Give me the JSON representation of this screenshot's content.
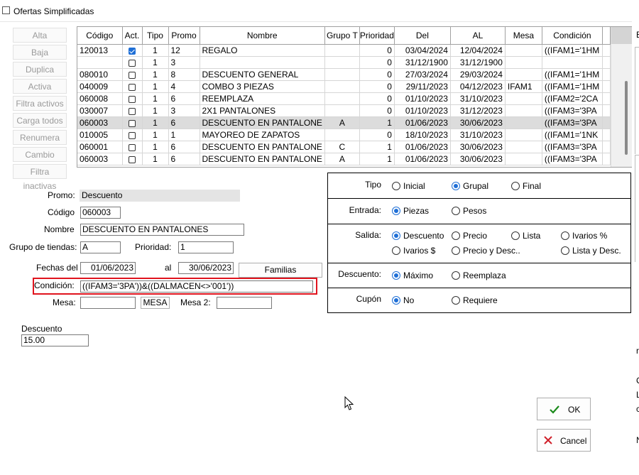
{
  "window": {
    "title": "Ofertas Simplificadas"
  },
  "side_buttons": [
    "Alta",
    "Baja",
    "Duplica",
    "Activa",
    "Filtra activos",
    "Carga todos",
    "Renumera",
    "Cambio",
    "Filtra inactivas"
  ],
  "grid": {
    "headers": [
      "Código",
      "Act.",
      "Tipo",
      "Promo",
      "Nombre",
      "Grupo T",
      "Prioridad",
      "Del",
      "AL",
      "Mesa",
      "Condición"
    ],
    "rows": [
      {
        "codigo": "120013",
        "act": true,
        "tipo": "1",
        "promo": "12",
        "nombre": "REGALO",
        "grupo": "",
        "prioridad": "0",
        "del": "03/04/2024",
        "al": "12/04/2024",
        "mesa": "",
        "condicion": "((IFAM1='1HM"
      },
      {
        "codigo": "",
        "act": false,
        "tipo": "1",
        "promo": "3",
        "nombre": "",
        "grupo": "",
        "prioridad": "0",
        "del": "31/12/1900",
        "al": "31/12/1900",
        "mesa": "",
        "condicion": ""
      },
      {
        "codigo": "080010",
        "act": false,
        "tipo": "1",
        "promo": "8",
        "nombre": "DESCUENTO GENERAL",
        "grupo": "",
        "prioridad": "0",
        "del": "27/03/2024",
        "al": "29/03/2024",
        "mesa": "",
        "condicion": "((IFAM1='1HM"
      },
      {
        "codigo": "040009",
        "act": false,
        "tipo": "1",
        "promo": "4",
        "nombre": "COMBO 3 PIEZAS",
        "grupo": "",
        "prioridad": "0",
        "del": "29/11/2023",
        "al": "04/12/2023",
        "mesa": "IFAM1",
        "condicion": "((IFAM1='1HM"
      },
      {
        "codigo": "060008",
        "act": false,
        "tipo": "1",
        "promo": "6",
        "nombre": "REEMPLAZA",
        "grupo": "",
        "prioridad": "0",
        "del": "01/10/2023",
        "al": "31/10/2023",
        "mesa": "",
        "condicion": "((IFAM2='2CA"
      },
      {
        "codigo": "030007",
        "act": false,
        "tipo": "1",
        "promo": "3",
        "nombre": "2X1 PANTALONES",
        "grupo": "",
        "prioridad": "0",
        "del": "01/10/2023",
        "al": "31/12/2023",
        "mesa": "",
        "condicion": "((IFAM3='3PA"
      },
      {
        "codigo": "060003",
        "act": false,
        "tipo": "1",
        "promo": "6",
        "nombre": "DESCUENTO EN PANTALONE",
        "grupo": "A",
        "prioridad": "1",
        "del": "01/06/2023",
        "al": "30/06/2023",
        "mesa": "",
        "condicion": "((IFAM3='3PA",
        "selected": true
      },
      {
        "codigo": "010005",
        "act": false,
        "tipo": "1",
        "promo": "1",
        "nombre": "MAYOREO DE ZAPATOS",
        "grupo": "",
        "prioridad": "0",
        "del": "18/10/2023",
        "al": "31/10/2023",
        "mesa": "",
        "condicion": "((IFAM1='1NK"
      },
      {
        "codigo": "060001",
        "act": false,
        "tipo": "1",
        "promo": "6",
        "nombre": "DESCUENTO EN PANTALONE",
        "grupo": "C",
        "prioridad": "1",
        "del": "01/06/2023",
        "al": "30/06/2023",
        "mesa": "",
        "condicion": "((IFAM3='3PA"
      },
      {
        "codigo": "060003",
        "act": false,
        "tipo": "1",
        "promo": "6",
        "nombre": "DESCUENTO EN PANTALONE",
        "grupo": "A",
        "prioridad": "1",
        "del": "01/06/2023",
        "al": "30/06/2023",
        "mesa": "",
        "condicion": "((IFAM3='3PA"
      }
    ]
  },
  "form": {
    "promo_label": "Promo:",
    "promo_value": "Descuento",
    "codigo_label": "Código",
    "codigo_value": "060003",
    "nombre_label": "Nombre",
    "nombre_value": "DESCUENTO EN PANTALONES",
    "grupo_label": "Grupo de tiendas:",
    "grupo_value": "A",
    "prioridad_label": "Prioridad:",
    "prioridad_value": "1",
    "fechas_label": "Fechas del",
    "fecha_del": "01/06/2023",
    "al_label": "al",
    "fecha_al": "30/06/2023",
    "familias_button": "Familias",
    "condicion_label": "Condición:",
    "condicion_value": "((IFAM3='3PA'))&((DALMACEN<>'001'))",
    "mesa_label": "Mesa:",
    "mesa_value": "",
    "mesa_button": "MESA",
    "mesa2_label": "Mesa 2:",
    "mesa2_value": "",
    "descuento_label": "Descuento",
    "descuento_value": "15.00"
  },
  "options": {
    "tipo": {
      "label": "Tipo",
      "opts": [
        "Inicial",
        "Grupal",
        "Final"
      ],
      "selected": "Grupal"
    },
    "entrada": {
      "label": "Entrada:",
      "opts": [
        "Piezas",
        "Pesos"
      ],
      "selected": "Piezas"
    },
    "salida": {
      "label": "Salida:",
      "opts": [
        "Descuento",
        "Precio",
        "Lista",
        "Ivarios %",
        "Ivarios $",
        "Precio y Desc..",
        "Lista y Desc."
      ],
      "selected": "Descuento"
    },
    "descuento": {
      "label": "Descuento:",
      "opts": [
        "Máximo",
        "Reemplaza"
      ],
      "selected": "Máximo"
    },
    "cupon": {
      "label": "Cupón",
      "opts": [
        "No",
        "Requiere"
      ],
      "selected": "No"
    }
  },
  "actions": {
    "ok": "OK",
    "cancel": "Cancel"
  },
  "right_fragments": [
    "E",
    "r",
    "C",
    "L",
    "c",
    "N"
  ],
  "colors": {
    "accent": "#1f6fd6",
    "highlight": "#e0141e",
    "ok_check": "#1a8a1a",
    "cancel_x": "#d0202a"
  }
}
